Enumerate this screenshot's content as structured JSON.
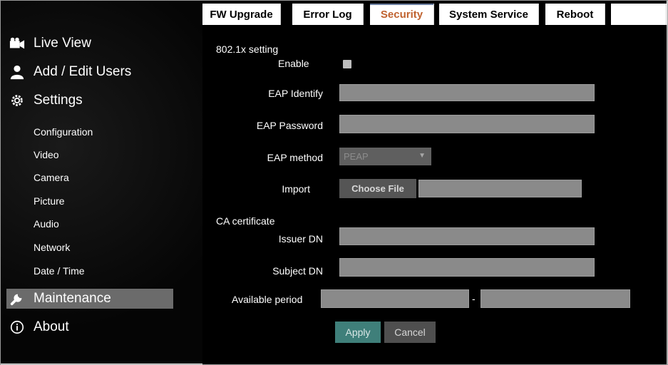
{
  "sidebar": {
    "main": [
      {
        "label": "Live View",
        "icon": "video-camera-icon"
      },
      {
        "label": "Add / Edit Users",
        "icon": "user-icon"
      },
      {
        "label": "Settings",
        "icon": "gear-icon"
      }
    ],
    "settings_items": [
      "Configuration",
      "Video",
      "Camera",
      "Picture",
      "Audio",
      "Network",
      "Date / Time"
    ],
    "maintenance": {
      "label": "Maintenance",
      "icon": "wrench-icon",
      "active": true
    },
    "about": {
      "label": "About",
      "icon": "info-icon"
    }
  },
  "tabs": [
    {
      "label": "FW Upgrade"
    },
    {
      "label": "Error Log"
    },
    {
      "label": "Security",
      "active": true
    },
    {
      "label": "System Service"
    },
    {
      "label": "Reboot"
    }
  ],
  "form": {
    "section_8021x": "802.1x setting",
    "enable_label": "Enable",
    "eap_identify_label": "EAP Identify",
    "eap_password_label": "EAP Password",
    "eap_method_label": "EAP method",
    "eap_method_value": "PEAP",
    "import_label": "Import",
    "choose_file_label": "Choose File",
    "ca_section": "CA certificate",
    "issuer_dn_label": "Issuer DN",
    "subject_dn_label": "Subject DN",
    "available_period_label": "Available period",
    "period_separator": "-",
    "apply_label": "Apply",
    "cancel_label": "Cancel"
  },
  "colors": {
    "active_tab_text": "#c0622f",
    "apply_button": "#3f7f7a",
    "active_nav_bg": "#6b6b6b"
  }
}
